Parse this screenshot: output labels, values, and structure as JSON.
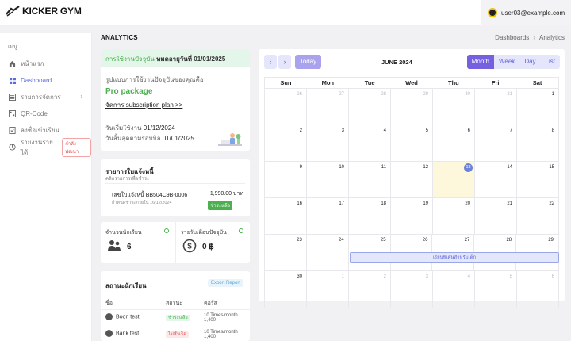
{
  "brand": {
    "name": "KICKER GYM"
  },
  "user": {
    "email": "user03@example.com"
  },
  "sidebar": {
    "header": "เมนู",
    "items": [
      {
        "label": "หน้าแรก",
        "icon": "home-icon"
      },
      {
        "label": "Dashboard",
        "icon": "dashboard-icon",
        "active": true
      },
      {
        "label": "รายการจัดการ",
        "icon": "list-icon"
      },
      {
        "label": "QR-Code",
        "icon": "qr-icon"
      },
      {
        "label": "ลงชื่อเข้าเรียน",
        "icon": "checkin-icon"
      },
      {
        "label": "รายงานรายได้",
        "icon": "report-icon",
        "badge": "กำลังพัฒนา"
      }
    ]
  },
  "page": {
    "title": "ANALYTICS"
  },
  "breadcrumb": {
    "parent": "Dashboards",
    "current": "Analytics"
  },
  "package": {
    "header_prefix": "การใช้งานปัจจุบัน",
    "header_value": "หมดอายุวันที่ 01/01/2025",
    "desc": "รูปแบบการใช้งานปัจจุบันของคุณคือ",
    "name": "Pro package",
    "link": "จัดการ subscription plan >>",
    "start_label": "วันเริ่มใช้งาน",
    "start_date": "01/12/2024",
    "end_label": "วันสิ้นสุดตามรอบบิล",
    "end_date": "01/01/2025"
  },
  "invoice": {
    "title": "รายการใบแจ้งหนี้",
    "subtitle": "คลิกรายการเพื่อชำระ",
    "number_label": "เลขใบแจ้งหนี้ BB504C9B-0006",
    "due_label": "กำหนดชำระภายใน 16/12/2024",
    "amount": "1,990.00 บาท",
    "status": "ชำระแล้ว"
  },
  "stats": {
    "students_label": "จำนวนนักเรียน",
    "students_value": "6",
    "revenue_label": "รายรับเดือนปัจจุบัน",
    "revenue_value": "0 ฿"
  },
  "student_status": {
    "title": "สถานะนักเรียน",
    "export": "Export Report",
    "columns": [
      "ชื่อ",
      "สถานะ",
      "คอร์ส"
    ],
    "rows": [
      {
        "name": "Boon test",
        "status": "ชำระแล้ว",
        "status_color": "green",
        "plan": "10 Times/month 1,400"
      },
      {
        "name": "Bank test",
        "status": "ไม่สำเร็จ",
        "status_color": "red",
        "plan": "10 Times/month 1,400"
      }
    ]
  },
  "calendar": {
    "today_label": "Today",
    "month_label": "JUNE 2024",
    "views": [
      "Month",
      "Week",
      "Day",
      "List"
    ],
    "active_view": "Month",
    "days_of_week": [
      "Sun",
      "Mon",
      "Tue",
      "Wed",
      "Thu",
      "Fri",
      "Sat"
    ],
    "weeks": [
      [
        "26",
        "27",
        "28",
        "29",
        "30",
        "31",
        "1"
      ],
      [
        "2",
        "3",
        "4",
        "5",
        "6",
        "7",
        "8"
      ],
      [
        "9",
        "10",
        "11",
        "12",
        "13",
        "14",
        "15"
      ],
      [
        "16",
        "17",
        "18",
        "19",
        "20",
        "21",
        "22"
      ],
      [
        "23",
        "24",
        "25",
        "26",
        "27",
        "28",
        "29"
      ],
      [
        "30",
        "1",
        "2",
        "3",
        "4",
        "5",
        "6"
      ]
    ],
    "today_date": "13",
    "event": {
      "title": "เรียนพิเศษสำหรับเด็ก"
    }
  }
}
